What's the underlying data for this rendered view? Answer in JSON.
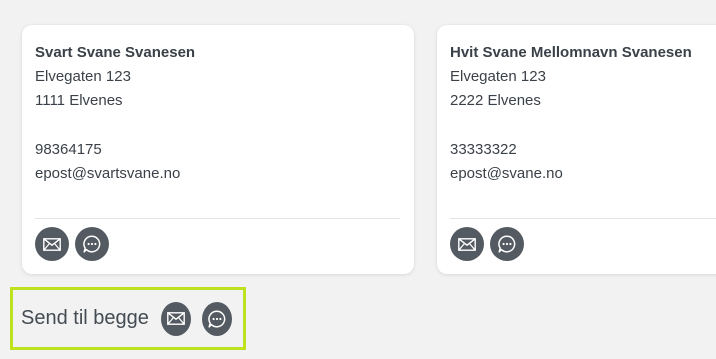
{
  "contacts": [
    {
      "name": "Svart Svane Svanesen",
      "address": "Elvegaten 123",
      "postal": "1111 Elvenes",
      "phone": "98364175",
      "email": "epost@svartsvane.no",
      "actions": {
        "email_icon": "envelope-icon",
        "sms_icon": "chat-bubble-icon"
      }
    },
    {
      "name": "Hvit Svane Mellomnavn Svanesen",
      "address": "Elvegaten 123",
      "postal": "2222 Elvenes",
      "phone": "33333322",
      "email": "epost@svane.no",
      "actions": {
        "email_icon": "envelope-icon",
        "sms_icon": "chat-bubble-icon"
      }
    }
  ],
  "send_both": {
    "label": "Send til begge",
    "email_icon": "envelope-icon",
    "sms_icon": "chat-bubble-icon",
    "highlight_color": "#bfe21f"
  },
  "colors": {
    "icon_button_bg": "#535a61",
    "text": "#3b4148",
    "background": "#f2f2f2"
  }
}
